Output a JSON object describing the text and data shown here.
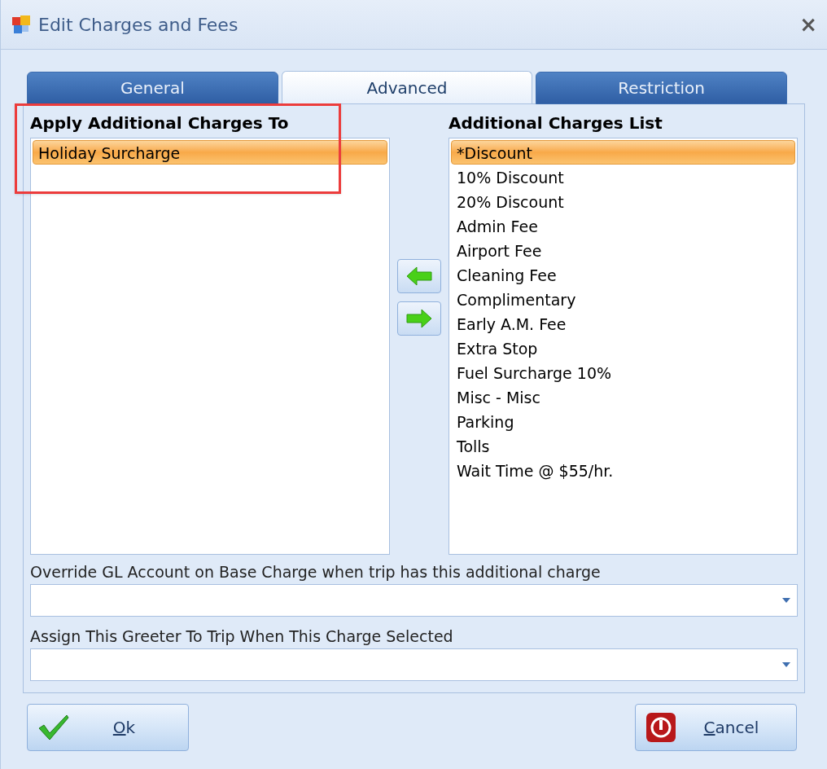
{
  "window": {
    "title": "Edit Charges and Fees",
    "close": "×"
  },
  "tabs": [
    {
      "label": "General",
      "selected": false
    },
    {
      "label": "Advanced",
      "selected": true
    },
    {
      "label": "Restriction",
      "selected": false
    }
  ],
  "applied_list": {
    "heading": "Apply Additional Charges To",
    "items": [
      {
        "label": "Holiday Surcharge",
        "selected": true
      }
    ],
    "highlighted": true
  },
  "available_list": {
    "heading": "Additional Charges List",
    "items": [
      {
        "label": "*Discount",
        "selected": true
      },
      {
        "label": "10% Discount",
        "selected": false
      },
      {
        "label": "20% Discount",
        "selected": false
      },
      {
        "label": "Admin Fee",
        "selected": false
      },
      {
        "label": "Airport Fee",
        "selected": false
      },
      {
        "label": "Cleaning Fee",
        "selected": false
      },
      {
        "label": "Complimentary",
        "selected": false
      },
      {
        "label": "Early A.M. Fee",
        "selected": false
      },
      {
        "label": "Extra Stop",
        "selected": false
      },
      {
        "label": "Fuel Surcharge 10%",
        "selected": false
      },
      {
        "label": "Misc - Misc",
        "selected": false
      },
      {
        "label": "Parking",
        "selected": false
      },
      {
        "label": "Tolls",
        "selected": false
      },
      {
        "label": "Wait Time @ $55/hr.",
        "selected": false
      }
    ]
  },
  "fields": [
    {
      "label": "Override GL Account on Base Charge when trip has this additional charge"
    },
    {
      "label": "Assign This Greeter To Trip When This Charge Selected"
    }
  ],
  "buttons": [
    {
      "kind": "ok",
      "label": "Ok"
    },
    {
      "kind": "cancel",
      "label": "Cancel"
    }
  ]
}
